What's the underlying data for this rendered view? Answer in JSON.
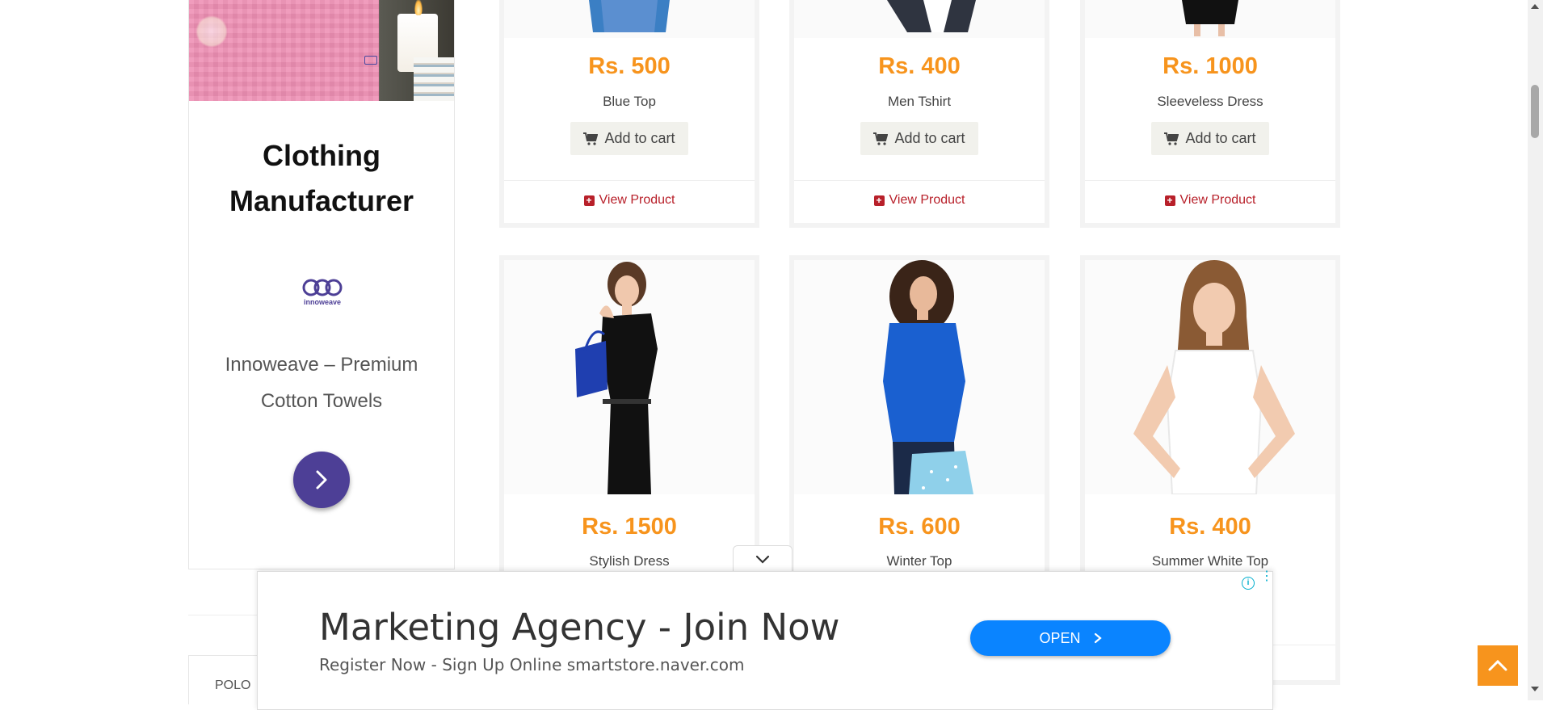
{
  "sidebar_ad": {
    "title_line1": "Clothing",
    "title_line2": "Manufacturer",
    "brand_name": "innoweave",
    "desc_line1": "Innoweave – Premium",
    "desc_line2": "Cotton Towels"
  },
  "category_tab": {
    "label": "POLO"
  },
  "products": [
    {
      "price": "Rs. 500",
      "name": "Blue Top",
      "cart_label": "Add to cart",
      "view_label": "View Product"
    },
    {
      "price": "Rs. 400",
      "name": "Men Tshirt",
      "cart_label": "Add to cart",
      "view_label": "View Product"
    },
    {
      "price": "Rs. 1000",
      "name": "Sleeveless Dress",
      "cart_label": "Add to cart",
      "view_label": "View Product"
    },
    {
      "price": "Rs. 1500",
      "name": "Stylish Dress"
    },
    {
      "price": "Rs. 600",
      "name": "Winter Top"
    },
    {
      "price": "Rs. 400",
      "name": "Summer White Top"
    }
  ],
  "ad_banner": {
    "headline": "Marketing Agency - Join Now",
    "subtext": "Register Now - Sign Up Online smartstore.naver.com",
    "open_label": "OPEN"
  },
  "colors": {
    "price": "#f7941d",
    "view_link": "#b8202a",
    "brand": "#4d3f96",
    "ad_button": "#0a84ff",
    "to_top": "#f7941d"
  },
  "icons": {
    "cart": "cart-icon",
    "view": "plus-square-icon",
    "next": "chevron-right-icon",
    "collapse": "chevron-down-icon",
    "to_top": "chevron-up-icon",
    "ad_info": "info-icon",
    "ad_more": "more-vertical-icon"
  }
}
